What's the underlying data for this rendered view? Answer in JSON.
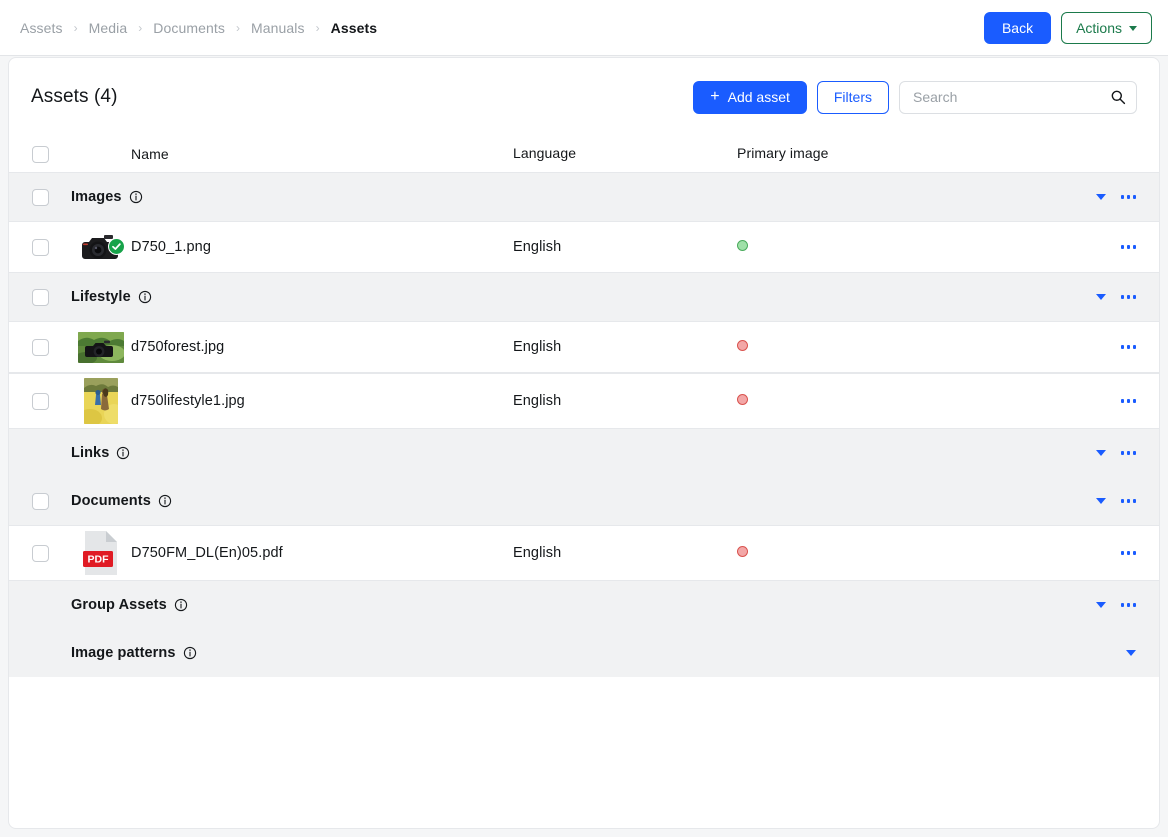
{
  "breadcrumb": {
    "separator": "›",
    "items": [
      {
        "label": "Assets",
        "active": false
      },
      {
        "label": "Media",
        "active": false
      },
      {
        "label": "Documents",
        "active": false
      },
      {
        "label": "Manuals",
        "active": false
      },
      {
        "label": "Assets",
        "active": true
      }
    ]
  },
  "topbar": {
    "back_label": "Back",
    "actions_label": "Actions"
  },
  "card": {
    "title": "Assets (4)",
    "add_asset_label": "Add asset",
    "add_asset_plus": "+",
    "filters_label": "Filters",
    "search": {
      "placeholder": "Search",
      "value": "",
      "icon": "search-icon"
    }
  },
  "table": {
    "columns": {
      "name": "Name",
      "language": "Language",
      "primary_image": "Primary image"
    },
    "rows": [
      {
        "kind": "group",
        "label": "Images",
        "info_icon": "info-icon",
        "checkbox": true,
        "chevron": true,
        "kebab": true
      },
      {
        "kind": "item",
        "name": "D750_1.png",
        "language": "English",
        "primary_image": "green",
        "thumb": "camera-dslr",
        "badge": "check-badge",
        "checkbox": true,
        "kebab": true
      },
      {
        "kind": "group",
        "label": "Lifestyle",
        "info_icon": "info-icon",
        "checkbox": true,
        "chevron": true,
        "kebab": true
      },
      {
        "kind": "item",
        "name": "d750forest.jpg",
        "language": "English",
        "primary_image": "red",
        "thumb": "forest-camera",
        "checkbox": true,
        "kebab": true
      },
      {
        "kind": "item",
        "name": "d750lifestyle1.jpg",
        "language": "English",
        "primary_image": "red",
        "thumb": "couple-field",
        "checkbox": true,
        "kebab": true
      },
      {
        "kind": "group",
        "label": "Links",
        "info_icon": "info-icon",
        "checkbox": false,
        "chevron": true,
        "kebab": true
      },
      {
        "kind": "group",
        "label": "Documents",
        "info_icon": "info-icon",
        "checkbox": true,
        "chevron": true,
        "kebab": true
      },
      {
        "kind": "item",
        "name": "D750FM_DL(En)05.pdf",
        "language": "English",
        "primary_image": "red",
        "thumb": "pdf-file",
        "thumb_label": "PDF",
        "checkbox": true,
        "kebab": true
      },
      {
        "kind": "group",
        "label": "Group Assets",
        "info_icon": "info-icon",
        "checkbox": false,
        "chevron": true,
        "kebab": true
      },
      {
        "kind": "group",
        "label": "Image patterns",
        "info_icon": "info-icon",
        "checkbox": false,
        "chevron": true,
        "kebab": false
      }
    ]
  },
  "colors": {
    "primary_blue": "#1a5cff",
    "actions_green": "#1b7a4b",
    "group_row_bg": "#f1f2f3",
    "status_green": "#9fe0a8",
    "status_red": "#f3a7a7",
    "pdf_red": "#e01b24"
  }
}
